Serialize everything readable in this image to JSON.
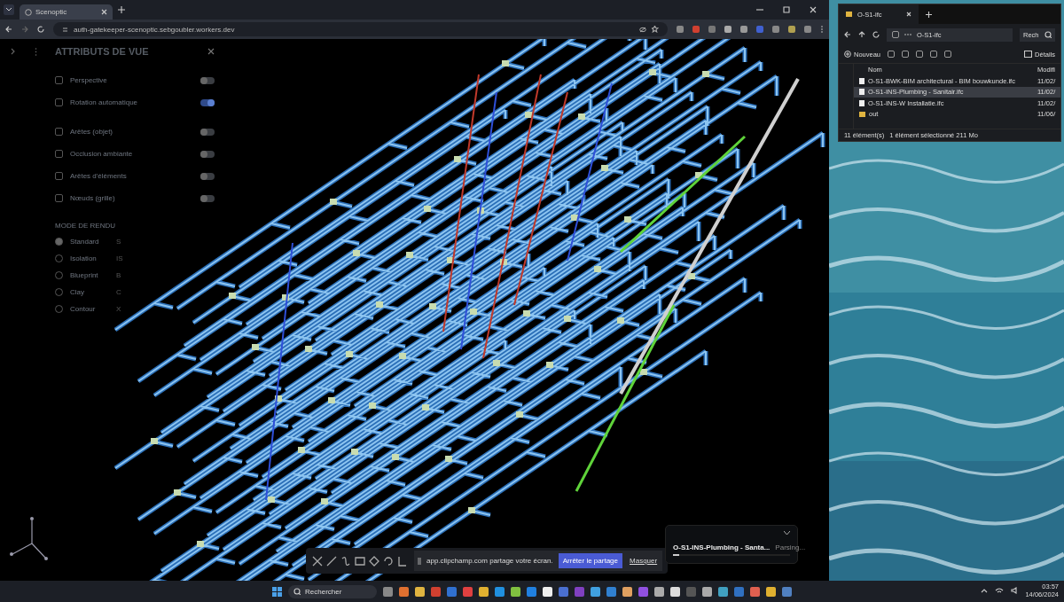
{
  "browser": {
    "tabs": [
      {
        "label": "Scenoptic",
        "selected": true
      }
    ],
    "url": "auth-gatekeeper-scenoptic.sebgoubler.workers.dev"
  },
  "panel": {
    "title": "ATTRIBUTS DE VUE",
    "toggles": [
      {
        "label": "Perspective",
        "on": false
      },
      {
        "label": "Rotation automatique",
        "on": true
      },
      {
        "label": "Arêtes (objet)",
        "on": false
      },
      {
        "label": "Occlusion ambiante",
        "on": false
      },
      {
        "label": "Arêtes d'éléments",
        "on": false
      },
      {
        "label": "Nœuds (grille)",
        "on": false
      }
    ],
    "section": "MODE DE RENDU",
    "render_modes": [
      {
        "label": "Standard",
        "shortcut": "S",
        "selected": true
      },
      {
        "label": "Isolation",
        "shortcut": "IS",
        "selected": false
      },
      {
        "label": "Blueprint",
        "shortcut": "B",
        "selected": false
      },
      {
        "label": "Clay",
        "shortcut": "C",
        "selected": false
      },
      {
        "label": "Contour",
        "shortcut": "X",
        "selected": false
      }
    ]
  },
  "share_bar": {
    "message": "app.clipchamp.com partage votre écran.",
    "stop": "Arrêter le partage",
    "hide": "Masquer"
  },
  "loading": {
    "file": "O-S1-INS-Plumbing - Santa...",
    "status": "Parsing...",
    "level": 0.05
  },
  "explorer": {
    "tab": "O-S1-ifc",
    "breadcrumb": "O-S1-ifc",
    "search": "Rech",
    "new": "Nouveau",
    "details": "Détails",
    "columns": [
      "Nom",
      "Modifi"
    ],
    "files": [
      {
        "name": "O-S1-BWK-BIM architectural - BIM bouwkunde.ifc",
        "date": "11/02/",
        "kind": "file",
        "selected": false
      },
      {
        "name": "O-S1-INS-Plumbing - Sanitair.ifc",
        "date": "11/02/",
        "kind": "file",
        "selected": true
      },
      {
        "name": "O-S1-INS-W Installatie.ifc",
        "date": "11/02/",
        "kind": "file",
        "selected": false
      },
      {
        "name": "out",
        "date": "11/06/",
        "kind": "folder",
        "selected": false
      }
    ],
    "count": "11 élément(s)",
    "selection": "1 élément sélectionné 211 Mo"
  },
  "taskbar": {
    "search": "Rechercher",
    "time": "03:57",
    "date": "14/06/2024"
  }
}
